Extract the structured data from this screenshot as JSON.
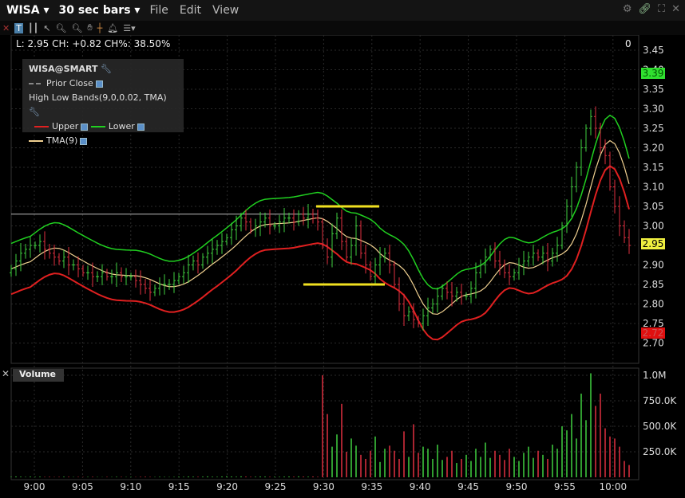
{
  "titlebar": {
    "symbol": "WISA",
    "interval": "30 sec bars",
    "menus": [
      "File",
      "Edit",
      "View"
    ]
  },
  "info": "L: 2.95 CH: +0.82 CH%: 38.50%",
  "pane_index": "0",
  "legend": {
    "title": "WISA@SMART",
    "prior_close": "Prior Close",
    "bands": "High Low Bands(9,0,0.02, TMA)",
    "upper": "Upper",
    "lower": "Lower",
    "tma": "TMA(9)"
  },
  "volume_label": "Volume",
  "colors": {
    "upper": "#e02020",
    "lower": "#20d020",
    "tma": "#f0d090",
    "up_bar": "#40d040",
    "down_bar": "#e03040",
    "annot": "#f0e020"
  },
  "badges": {
    "high": "3.39",
    "low": "2.72",
    "last": "2.95"
  },
  "chart_data": {
    "type": "candlestick",
    "price_ticks": [
      "3.45",
      "3.40",
      "3.35",
      "3.30",
      "3.25",
      "3.20",
      "3.15",
      "3.10",
      "3.05",
      "3.00",
      "2.95",
      "2.90",
      "2.85",
      "2.80",
      "2.75",
      "2.70"
    ],
    "price_range": [
      2.665,
      3.49
    ],
    "volume_ticks": [
      "1.0M",
      "750.0K",
      "500.0K",
      "250.0K"
    ],
    "time_ticks": [
      "9:00",
      "9:05",
      "9:10",
      "9:15",
      "9:20",
      "9:25",
      "9:30",
      "9:35",
      "9:40",
      "9:45",
      "9:50",
      "9:55",
      "10:00"
    ],
    "prior_close_level": 3.03,
    "annotations": [
      3.05,
      2.85
    ],
    "closes": [
      2.89,
      2.91,
      2.93,
      2.94,
      2.95,
      2.95,
      2.96,
      2.94,
      2.93,
      2.92,
      2.91,
      2.92,
      2.9,
      2.9,
      2.89,
      2.88,
      2.88,
      2.87,
      2.87,
      2.88,
      2.87,
      2.87,
      2.88,
      2.87,
      2.87,
      2.87,
      2.86,
      2.85,
      2.84,
      2.83,
      2.84,
      2.85,
      2.85,
      2.85,
      2.86,
      2.87,
      2.88,
      2.9,
      2.91,
      2.9,
      2.92,
      2.93,
      2.94,
      2.95,
      2.96,
      2.97,
      2.99,
      3.0,
      3.02,
      3.01,
      2.99,
      3.0,
      3.01,
      3.02,
      3.0,
      3.0,
      3.01,
      3.02,
      3.02,
      3.01,
      3.03,
      3.02,
      3.03,
      3.02,
      3.01,
      2.95,
      2.92,
      2.98,
      3.02,
      2.96,
      2.92,
      2.95,
      3.0,
      2.93,
      2.9,
      2.87,
      2.9,
      2.92,
      2.93,
      2.9,
      2.85,
      2.8,
      2.77,
      2.78,
      2.76,
      2.75,
      2.77,
      2.79,
      2.8,
      2.82,
      2.84,
      2.83,
      2.82,
      2.83,
      2.82,
      2.82,
      2.84,
      2.88,
      2.9,
      2.92,
      2.94,
      2.91,
      2.9,
      2.88,
      2.87,
      2.88,
      2.9,
      2.91,
      2.92,
      2.93,
      2.92,
      2.93,
      2.91,
      2.93,
      2.95,
      3.0,
      3.05,
      3.1,
      3.15,
      3.2,
      3.25,
      3.28,
      3.25,
      3.2,
      3.18,
      3.1,
      3.05,
      3.0,
      2.97,
      2.95
    ],
    "volumes_k": [
      5,
      8,
      6,
      4,
      7,
      5,
      6,
      4,
      5,
      3,
      4,
      6,
      5,
      3,
      4,
      3,
      4,
      5,
      3,
      2,
      4,
      3,
      5,
      4,
      3,
      4,
      3,
      5,
      6,
      4,
      3,
      5,
      4,
      3,
      4,
      6,
      5,
      8,
      6,
      5,
      7,
      9,
      6,
      5,
      8,
      10,
      8,
      6,
      9,
      7,
      5,
      6,
      8,
      7,
      5,
      6,
      5,
      7,
      8,
      6,
      9,
      7,
      6,
      8,
      5,
      1000,
      620,
      300,
      420,
      720,
      250,
      380,
      310,
      220,
      180,
      260,
      400,
      150,
      280,
      310,
      260,
      180,
      450,
      200,
      520,
      240,
      300,
      280,
      180,
      320,
      170,
      200,
      260,
      140,
      180,
      220,
      160,
      280,
      200,
      340,
      190,
      260,
      220,
      170,
      280,
      200,
      160,
      240,
      300,
      190,
      260,
      220,
      180,
      320,
      280,
      500,
      460,
      620,
      380,
      820,
      560,
      1020,
      700,
      820,
      480,
      400,
      380,
      300,
      160,
      120
    ]
  }
}
